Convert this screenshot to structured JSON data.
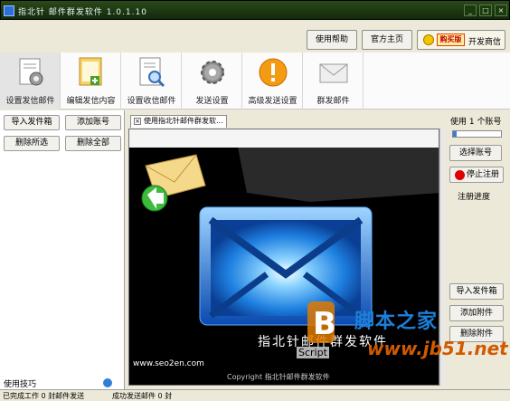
{
  "window": {
    "title": "指北针 邮件群发软件 1.0.1.10"
  },
  "topbar": {
    "help": "使用帮助",
    "homepage": "官方主页",
    "buy_tag": "购买版",
    "buy_label": "开发商信"
  },
  "toolbar": [
    {
      "label": "设置发信邮件",
      "icon": "gear-document-icon"
    },
    {
      "label": "编辑发信内容",
      "icon": "edit-document-icon"
    },
    {
      "label": "设置收信邮件",
      "icon": "search-document-icon"
    },
    {
      "label": "发送设置",
      "icon": "gear-icon"
    },
    {
      "label": "高级发送设置",
      "icon": "warning-icon"
    },
    {
      "label": "群发邮件",
      "icon": "envelope-icon"
    }
  ],
  "left": {
    "buttons": [
      "导入发件箱",
      "添加账号",
      "删除所选",
      "删除全部"
    ],
    "tips": "使用技巧"
  },
  "tab": {
    "label": "使用指北针邮件群发软..."
  },
  "preview": {
    "brand_text": "指北针邮件群发软件",
    "url": "www.seo2en.com",
    "copyright": "Copyright 指北针邮件群发软件"
  },
  "right": {
    "account_count": "使用 1 个账号",
    "progress": 0.08,
    "select_account": "选择账号",
    "stop": "停止注册",
    "reg_progress": "注册进度",
    "import_label": "导入发件箱",
    "add_attach": "添加附件",
    "delete_attach": "删除附件"
  },
  "status": {
    "left": "已完成工作 0 封邮件发送",
    "right": "成功发送邮件 0 封"
  },
  "watermark": {
    "site_name": "脚本之家",
    "site_url": "www.jb51.net",
    "script_label": "Script"
  },
  "colors": {
    "titlebar": "#1f3a12",
    "accent": "#2f7fd8",
    "buy_red": "#c00000"
  }
}
